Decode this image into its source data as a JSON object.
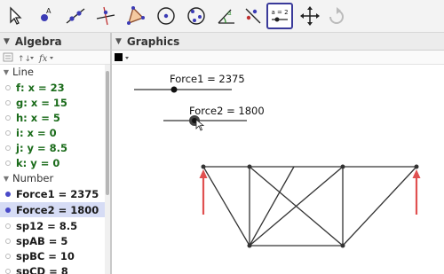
{
  "toolbar": {
    "tools": [
      {
        "name": "move-tool",
        "selected": false
      },
      {
        "name": "point-tool",
        "selected": false
      },
      {
        "name": "line-tool",
        "selected": false
      },
      {
        "name": "perpendicular-line-tool",
        "selected": false
      },
      {
        "name": "polygon-tool",
        "selected": false
      },
      {
        "name": "circle-center-point-tool",
        "selected": false
      },
      {
        "name": "circle-three-points-tool",
        "selected": false
      },
      {
        "name": "angle-tool",
        "selected": false
      },
      {
        "name": "reflect-tool",
        "selected": false
      },
      {
        "name": "slider-tool",
        "selected": true
      },
      {
        "name": "move-graphics-view-tool",
        "selected": false
      }
    ],
    "slider_icon_text": "a = 2"
  },
  "algebra": {
    "title": "Algebra",
    "style_icons": [
      "algebra-sort-icon",
      "algebra-fx-icon"
    ],
    "fx_label": "fx",
    "categories": [
      {
        "label": "Line",
        "items": [
          {
            "text": "f: x = 23",
            "active": false,
            "selected": false
          },
          {
            "text": "g: x = 15",
            "active": false,
            "selected": false
          },
          {
            "text": "h: x = 5",
            "active": false,
            "selected": false
          },
          {
            "text": "i: x = 0",
            "active": false,
            "selected": false
          },
          {
            "text": "j: y = 8.5",
            "active": false,
            "selected": false
          },
          {
            "text": "k: y = 0",
            "active": false,
            "selected": false
          }
        ]
      },
      {
        "label": "Number",
        "items": [
          {
            "text": "Force1 = 2375",
            "active": true,
            "selected": false
          },
          {
            "text": "Force2 = 1800",
            "active": true,
            "selected": true
          },
          {
            "text": "sp12 = 8.5",
            "active": false,
            "selected": false
          },
          {
            "text": "spAB = 5",
            "active": false,
            "selected": false
          },
          {
            "text": "spBC = 10",
            "active": false,
            "selected": false
          },
          {
            "text": "spCD = 8",
            "active": false,
            "selected": false
          }
        ]
      }
    ]
  },
  "graphics": {
    "title": "Graphics",
    "color_swatch": "#000000",
    "sliders": [
      {
        "label": "Force1 = 2375",
        "value": 2375
      },
      {
        "label": "Force2 = 1800",
        "value": 1800
      }
    ],
    "truss_color": "#333333",
    "arrow_color": "#e05050"
  },
  "colors": {
    "line_text": "#1a6b1a",
    "selection": "#d6dcf5",
    "accent": "#3a3a9a"
  }
}
